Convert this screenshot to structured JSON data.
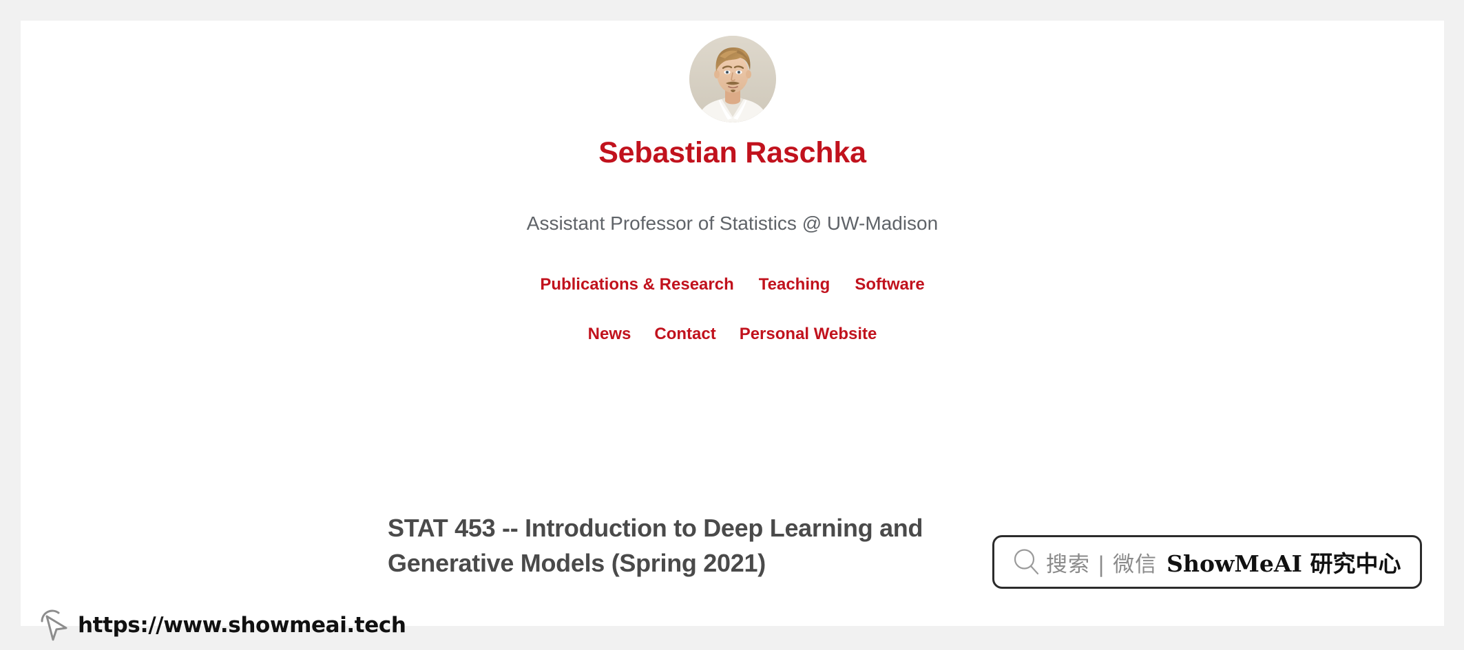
{
  "page": {
    "background_color": "#f1f1f1",
    "panel_color": "#ffffff"
  },
  "profile": {
    "avatar_name": "avatar-photo-sebastian-raschka",
    "name": "Sebastian Raschka",
    "tagline": "Assistant Professor of Statistics @ UW-Madison",
    "name_color": "#c1121d",
    "tagline_color": "#5f6368"
  },
  "nav": {
    "row1": [
      {
        "label": "Publications & Research"
      },
      {
        "label": "Teaching"
      },
      {
        "label": "Software"
      }
    ],
    "row2": [
      {
        "label": "News"
      },
      {
        "label": "Contact"
      },
      {
        "label": "Personal Website"
      }
    ],
    "link_color": "#c1121d"
  },
  "main": {
    "heading_line_1": "STAT 453 -- Introduction to Deep Learning and",
    "heading_line_2": "Generative Models (Spring 2021)",
    "heading_color": "#4a4a4a"
  },
  "watermark": {
    "search_icon": "search-icon",
    "search_label": "搜索 | 微信",
    "brand": "ShowMeAI 研究中心",
    "border_color": "#2b2b2b",
    "label_color": "#8a8a8a",
    "brand_color": "#111111"
  },
  "overlay": {
    "cursor_icon": "pointer-click-cursor-icon",
    "url": "https://www.showmeai.tech",
    "url_color": "#111111"
  }
}
